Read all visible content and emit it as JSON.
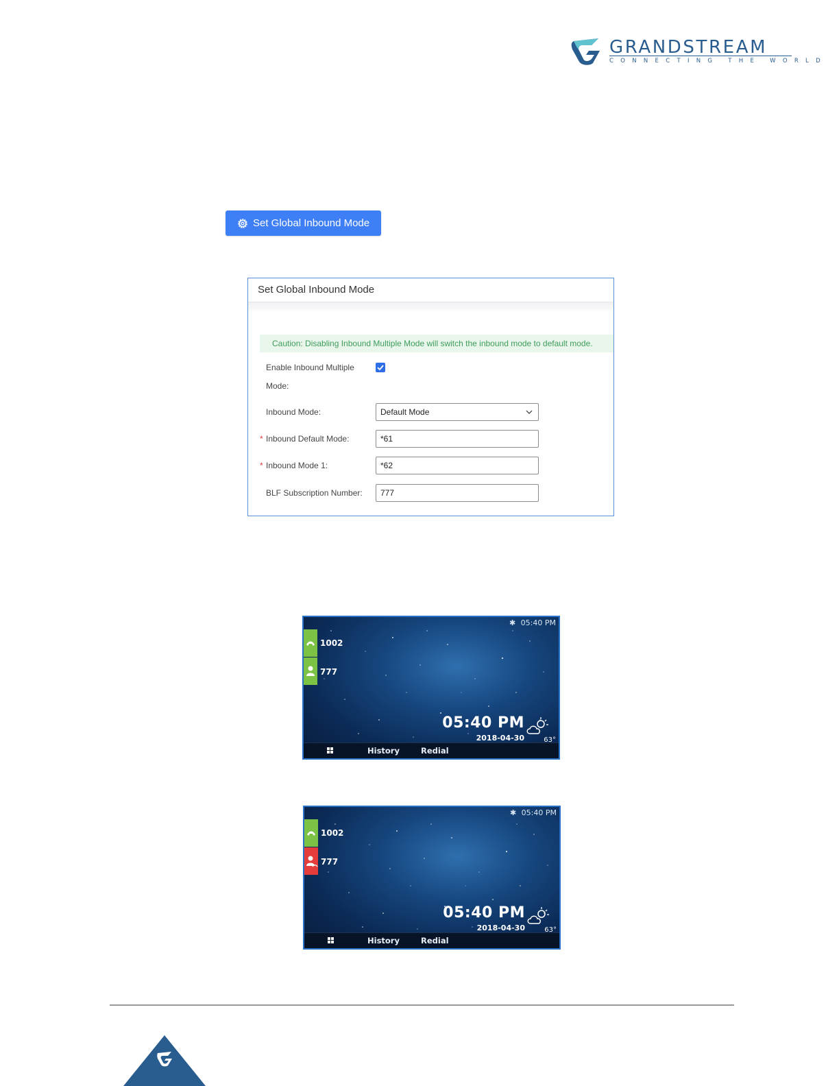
{
  "logo": {
    "name": "GRANDSTREAM",
    "tagline": "CONNECTING THE WORLD",
    "color": "#2a5d8f"
  },
  "global_button": {
    "label": "Set Global Inbound Mode",
    "icon": "gear-icon",
    "color": "#3e7ff5"
  },
  "dialog": {
    "title": "Set Global Inbound Mode",
    "caution": "Caution: Disabling Inbound Multiple Mode will switch the inbound mode to default mode.",
    "enable_label_line1": "Enable Inbound Multiple",
    "enable_label_line2": "Mode:",
    "enable_checked": true,
    "inbound_mode_label": "Inbound Mode:",
    "inbound_mode_value": "Default Mode",
    "default_mode_label": "Inbound Default Mode:",
    "default_mode_value": "*61",
    "mode1_label": "Inbound Mode 1:",
    "mode1_value": "*62",
    "blf_label": "BLF Subscription Number:",
    "blf_value": "777",
    "required_mark": "*"
  },
  "phones": [
    {
      "status_time": "05:40 PM",
      "lines": [
        {
          "label": "1002",
          "color": "#7cc244",
          "icon": "handset-icon"
        },
        {
          "label": "777",
          "color": "#7cc244",
          "icon": "person-icon"
        }
      ],
      "clock": "05:40 PM",
      "date": "2018-04-30",
      "temperature": "63°",
      "softkeys": {
        "history": "History",
        "redial": "Redial"
      }
    },
    {
      "status_time": "05:40 PM",
      "lines": [
        {
          "label": "1002",
          "color": "#7cc244",
          "icon": "handset-icon"
        },
        {
          "label": "777",
          "color": "#e63b3b",
          "icon": "person-busy-icon"
        }
      ],
      "clock": "05:40 PM",
      "date": "2018-04-30",
      "temperature": "63°",
      "softkeys": {
        "history": "History",
        "redial": "Redial"
      }
    }
  ]
}
